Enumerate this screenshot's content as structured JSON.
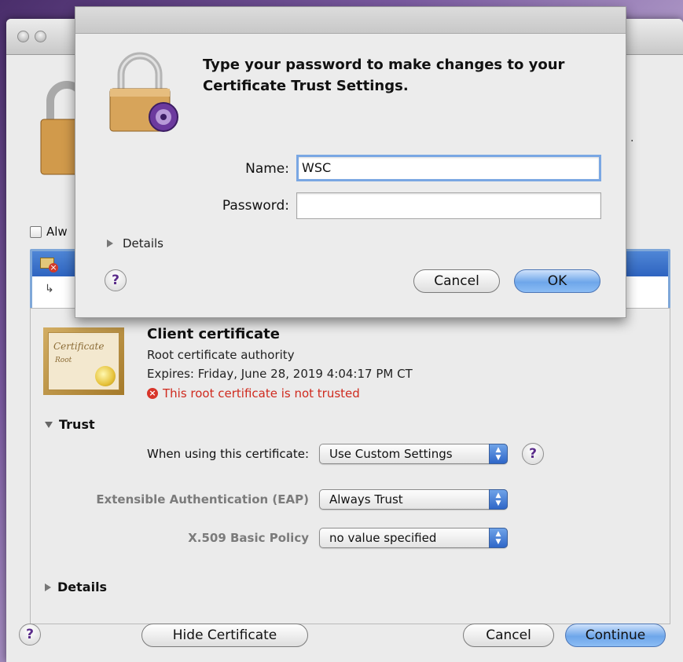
{
  "sheet": {
    "message": "Type your password to make changes to your Certificate Trust Settings.",
    "name_label": "Name:",
    "name_value": "WSC",
    "password_label": "Password:",
    "password_value": "",
    "details_label": "Details",
    "help_label": "?",
    "cancel_label": "Cancel",
    "ok_label": "OK"
  },
  "window": {
    "always_label": "Alw"
  },
  "certificate": {
    "image_text_1": "Certificate",
    "image_text_2": "Root",
    "name": "Client certificate",
    "type": "Root certificate authority",
    "expires": "Expires: Friday, June 28, 2019 4:04:17 PM CT",
    "warning": "This root certificate is not trusted",
    "trust_section": "Trust",
    "when_using_label": "When using this certificate:",
    "when_using_value": "Use Custom Settings",
    "eap_label": "Extensible Authentication (EAP)",
    "eap_value": "Always Trust",
    "x509_label": "X.509 Basic Policy",
    "x509_value": "no value specified",
    "details_section": "Details",
    "help_label": "?"
  },
  "footer": {
    "help_label": "?",
    "hide_certificate_label": "Hide Certificate",
    "cancel_label": "Cancel",
    "continue_label": "Continue"
  },
  "colors": {
    "accent_blue": "#6ea6ea",
    "warning_red": "#cf2a1e",
    "help_purple": "#5a2b8a"
  }
}
